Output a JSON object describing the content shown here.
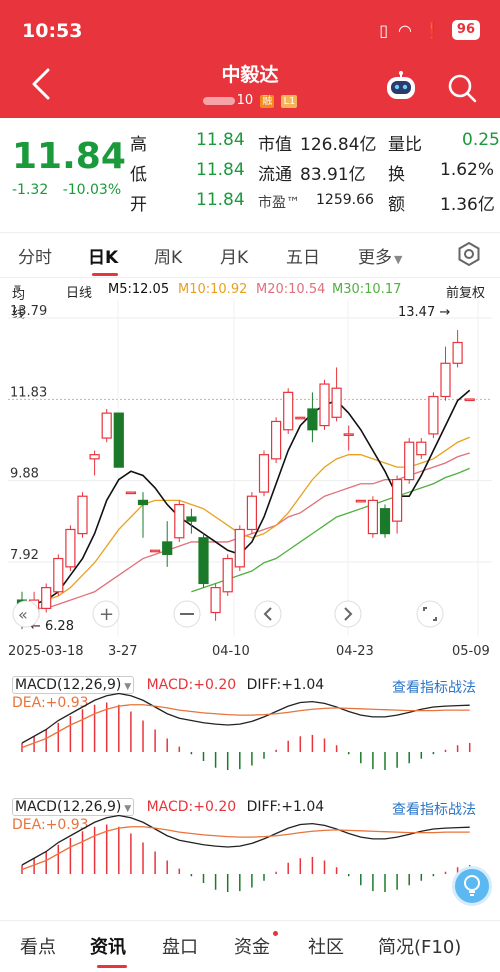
{
  "status_bar": {
    "time": "10:53",
    "battery": "96"
  },
  "header": {
    "title": "中毅达",
    "code_suffix": "10",
    "tag_margin": "融",
    "tag_level": "L1"
  },
  "quote": {
    "price": "11.84",
    "change": "-1.32",
    "change_pct": "-10.03%",
    "high_label": "高",
    "high": "11.84",
    "low_label": "低",
    "low": "11.84",
    "open_label": "开",
    "open": "11.84",
    "mcap_label": "市值",
    "mcap": "126.84亿",
    "float_label": "流通",
    "float": "83.91亿",
    "pe_label": "市盈™",
    "pe": "1259.66",
    "vol_ratio_label": "量比",
    "vol_ratio": "0.25",
    "turnover_label": "换",
    "turnover": "1.62%",
    "amount_label": "额",
    "amount": "1.36亿"
  },
  "tabs": {
    "items": [
      "分时",
      "日K",
      "周K",
      "月K",
      "五日",
      "更多"
    ],
    "active": "日K"
  },
  "ma_row": {
    "ma_selector": "均线",
    "period": "日线",
    "m5": "M5:12.05",
    "m10": "M10:10.92",
    "m20": "M20:10.54",
    "m30": "M30:10.17",
    "adjust": "前复权"
  },
  "colors": {
    "up": "#e8343c",
    "down": "#1a7a2a",
    "m5": "#111111",
    "m10": "#e8a020",
    "m20": "#e0707a",
    "m30": "#50b040",
    "dif": "#222222",
    "dea": "#e8743c"
  },
  "chart_data": {
    "type": "candlestick",
    "y_ticks": [
      "13.79",
      "11.83",
      "9.88",
      "7.92",
      "6.28"
    ],
    "ylim": [
      6.28,
      13.79
    ],
    "y_tick_values": [
      13.79,
      11.83,
      9.88,
      7.92
    ],
    "high_marker": "13.47",
    "low_marker": "6.28",
    "x_labels": [
      "2025-03-18",
      "3-27",
      "04-10",
      "04-23",
      "05-09"
    ],
    "candles": [
      {
        "o": 7.0,
        "c": 6.6,
        "h": 7.2,
        "l": 6.3
      },
      {
        "o": 6.6,
        "c": 7.0,
        "h": 7.2,
        "l": 6.4
      },
      {
        "o": 6.8,
        "c": 7.3,
        "h": 7.4,
        "l": 6.7
      },
      {
        "o": 7.2,
        "c": 8.0,
        "h": 8.1,
        "l": 7.1
      },
      {
        "o": 7.8,
        "c": 8.7,
        "h": 8.8,
        "l": 7.7
      },
      {
        "o": 8.6,
        "c": 9.5,
        "h": 9.6,
        "l": 8.5
      },
      {
        "o": 10.4,
        "c": 10.5,
        "h": 10.6,
        "l": 10.0
      },
      {
        "o": 10.9,
        "c": 11.5,
        "h": 11.6,
        "l": 10.8
      },
      {
        "o": 11.5,
        "c": 10.2,
        "h": 11.5,
        "l": 10.2
      },
      {
        "o": 9.6,
        "c": 9.6,
        "h": 9.6,
        "l": 9.6
      },
      {
        "o": 9.4,
        "c": 9.3,
        "h": 9.6,
        "l": 8.5
      },
      {
        "o": 8.2,
        "c": 8.2,
        "h": 8.2,
        "l": 8.2
      },
      {
        "o": 8.4,
        "c": 8.1,
        "h": 8.9,
        "l": 7.8
      },
      {
        "o": 8.5,
        "c": 9.3,
        "h": 9.4,
        "l": 8.4
      },
      {
        "o": 9.0,
        "c": 8.9,
        "h": 9.2,
        "l": 8.6
      },
      {
        "o": 8.5,
        "c": 7.4,
        "h": 8.6,
        "l": 7.3
      },
      {
        "o": 6.7,
        "c": 7.3,
        "h": 7.4,
        "l": 6.5
      },
      {
        "o": 7.2,
        "c": 8.0,
        "h": 8.1,
        "l": 7.1
      },
      {
        "o": 7.8,
        "c": 8.7,
        "h": 8.8,
        "l": 7.7
      },
      {
        "o": 8.7,
        "c": 9.5,
        "h": 9.6,
        "l": 8.6
      },
      {
        "o": 9.6,
        "c": 10.5,
        "h": 10.6,
        "l": 9.5
      },
      {
        "o": 10.4,
        "c": 11.3,
        "h": 11.4,
        "l": 10.3
      },
      {
        "o": 11.1,
        "c": 12.0,
        "h": 12.1,
        "l": 11.0
      },
      {
        "o": 11.4,
        "c": 11.4,
        "h": 11.4,
        "l": 11.4
      },
      {
        "o": 11.6,
        "c": 11.1,
        "h": 12.0,
        "l": 10.8
      },
      {
        "o": 11.2,
        "c": 12.2,
        "h": 12.3,
        "l": 11.1
      },
      {
        "o": 11.4,
        "c": 12.1,
        "h": 12.6,
        "l": 11.3
      },
      {
        "o": 11.0,
        "c": 11.0,
        "h": 11.2,
        "l": 10.6
      },
      {
        "o": 9.4,
        "c": 9.4,
        "h": 9.4,
        "l": 9.4
      },
      {
        "o": 8.6,
        "c": 9.4,
        "h": 9.5,
        "l": 8.5
      },
      {
        "o": 9.2,
        "c": 8.6,
        "h": 9.3,
        "l": 8.5
      },
      {
        "o": 8.9,
        "c": 9.9,
        "h": 10.0,
        "l": 8.6
      },
      {
        "o": 9.9,
        "c": 10.8,
        "h": 10.9,
        "l": 9.8
      },
      {
        "o": 10.5,
        "c": 10.8,
        "h": 10.9,
        "l": 10.4
      },
      {
        "o": 11.0,
        "c": 11.9,
        "h": 12.0,
        "l": 10.9
      },
      {
        "o": 11.9,
        "c": 12.7,
        "h": 13.1,
        "l": 11.8
      },
      {
        "o": 12.7,
        "c": 13.2,
        "h": 13.5,
        "l": 12.6
      },
      {
        "o": 11.84,
        "c": 11.84,
        "h": 11.84,
        "l": 11.84
      }
    ],
    "m5": [
      6.9,
      6.9,
      7.0,
      7.2,
      7.6,
      8.0,
      8.6,
      9.4,
      9.9,
      10.1,
      10.0,
      9.7,
      9.3,
      9.0,
      8.8,
      8.6,
      8.4,
      8.2,
      8.1,
      8.4,
      9.0,
      9.8,
      10.6,
      11.2,
      11.5,
      11.7,
      11.8,
      11.5,
      11.1,
      10.6,
      10.1,
      9.5,
      9.5,
      10.0,
      10.6,
      11.2,
      11.8,
      12.05
    ],
    "m10": [
      6.9,
      6.9,
      7.0,
      7.1,
      7.3,
      7.6,
      7.9,
      8.3,
      8.7,
      9.0,
      9.3,
      9.4,
      9.4,
      9.4,
      9.3,
      9.2,
      9.0,
      8.8,
      8.6,
      8.5,
      8.6,
      8.8,
      9.1,
      9.5,
      9.9,
      10.2,
      10.4,
      10.5,
      10.5,
      10.4,
      10.3,
      10.2,
      10.2,
      10.3,
      10.4,
      10.6,
      10.8,
      10.92
    ],
    "m20": [
      6.8,
      6.8,
      6.8,
      6.9,
      7.0,
      7.1,
      7.2,
      7.4,
      7.6,
      7.8,
      8.0,
      8.1,
      8.2,
      8.3,
      8.4,
      8.4,
      8.4,
      8.4,
      8.5,
      8.6,
      8.7,
      8.8,
      9.0,
      9.1,
      9.3,
      9.5,
      9.6,
      9.7,
      9.8,
      9.8,
      9.9,
      9.9,
      10.0,
      10.1,
      10.2,
      10.3,
      10.45,
      10.54
    ],
    "m30": [
      null,
      null,
      null,
      null,
      null,
      null,
      null,
      null,
      null,
      null,
      null,
      null,
      null,
      null,
      7.2,
      7.3,
      7.4,
      7.5,
      7.6,
      7.7,
      7.9,
      8.0,
      8.2,
      8.4,
      8.6,
      8.8,
      9.0,
      9.1,
      9.2,
      9.3,
      9.4,
      9.5,
      9.6,
      9.7,
      9.8,
      9.95,
      10.05,
      10.17
    ]
  },
  "macd": {
    "label": "MACD(12,26,9)",
    "macd_value": "MACD:+0.20",
    "diff_value": "DIFF:+1.04",
    "dea_value": "DEA:+0.93",
    "link": "查看指标战法",
    "hist": [
      0.2,
      0.35,
      0.5,
      0.65,
      0.8,
      0.95,
      1.05,
      1.1,
      1.05,
      0.9,
      0.7,
      0.5,
      0.3,
      0.12,
      -0.05,
      -0.2,
      -0.35,
      -0.4,
      -0.38,
      -0.3,
      -0.15,
      0.05,
      0.25,
      0.35,
      0.38,
      0.3,
      0.15,
      -0.05,
      -0.25,
      -0.38,
      -0.4,
      -0.35,
      -0.25,
      -0.15,
      -0.05,
      0.05,
      0.15,
      0.2
    ],
    "dif": [
      0.2,
      0.35,
      0.5,
      0.7,
      0.85,
      1.0,
      1.15,
      1.25,
      1.3,
      1.25,
      1.15,
      1.0,
      0.85,
      0.75,
      0.7,
      0.65,
      0.62,
      0.6,
      0.62,
      0.68,
      0.78,
      0.9,
      1.02,
      1.1,
      1.12,
      1.08,
      1.0,
      0.9,
      0.82,
      0.78,
      0.78,
      0.82,
      0.88,
      0.95,
      1.0,
      1.02,
      1.03,
      1.04
    ],
    "dea": [
      0.1,
      0.2,
      0.3,
      0.45,
      0.6,
      0.72,
      0.85,
      0.95,
      1.02,
      1.05,
      1.05,
      1.02,
      0.98,
      0.93,
      0.9,
      0.87,
      0.85,
      0.83,
      0.82,
      0.82,
      0.83,
      0.85,
      0.88,
      0.92,
      0.95,
      0.97,
      0.98,
      0.97,
      0.96,
      0.95,
      0.94,
      0.93,
      0.92,
      0.92,
      0.92,
      0.93,
      0.93,
      0.93
    ]
  },
  "bottom_nav": {
    "items": [
      "看点",
      "资讯",
      "盘口",
      "资金",
      "社区",
      "简况(F10)"
    ],
    "active": "资讯"
  }
}
